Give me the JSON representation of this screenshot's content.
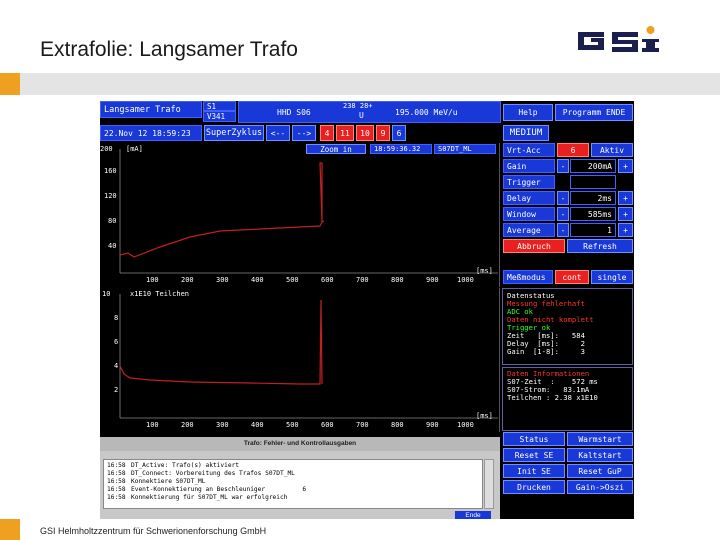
{
  "slide": {
    "title": "Extrafolie: Langsamer Trafo",
    "footer": "GSI Helmholtzzentrum für Schwerionenforschung GmbH",
    "logo_text": "GSI"
  },
  "topbar": {
    "device_name": "Langsamer Trafo",
    "id1": "S1",
    "id2": "V341",
    "beam_line1": "238  28+",
    "beam_element": "HHD S06",
    "beam_ion": "U",
    "beam_energy": "195.000 MeV/u",
    "date": "22.Nov 12 18:59:23",
    "cycle": "SuperZyklus",
    "nav_back": "<--",
    "nav_fwd": "-->",
    "cycle_numbers": [
      "4",
      "11",
      "10",
      "9",
      "6"
    ],
    "zoom_label": "Zoom in",
    "zoom_time": "18:59:36.32",
    "zoom_device": "S07DT_ML"
  },
  "plot1": {
    "unit_label": "[mA]",
    "x_unit": "[ms]",
    "y_ticks": [
      "200",
      "160",
      "120",
      "80",
      "40"
    ],
    "x_ticks": [
      "100",
      "200",
      "300",
      "400",
      "500",
      "600",
      "700",
      "800",
      "900",
      "1000"
    ]
  },
  "plot2": {
    "unit_label": "x1E10 Teilchen",
    "x_unit": "[ms]",
    "y_ticks": [
      "10",
      "8",
      "6",
      "4",
      "2"
    ],
    "x_ticks": [
      "100",
      "200",
      "300",
      "400",
      "500",
      "600",
      "700",
      "800",
      "900",
      "1000"
    ]
  },
  "controls": {
    "help": "Help",
    "end_program": "Programm ENDE",
    "range": "MEDIUM",
    "vrtacc_label": "Vrt-Acc",
    "vrtacc_value": "6",
    "vrtacc_state": "Aktiv",
    "gain_label": "Gain",
    "gain_value": "200mA",
    "trigger_label": "Trigger",
    "delay_label": "Delay",
    "delay_value": "2ms",
    "window_label": "Window",
    "window_value": "585ms",
    "average_label": "Average",
    "average_value": "1",
    "minus": "-",
    "plus": "+",
    "abort": "Abbruch",
    "refresh": "Refresh",
    "mode_label": "Meßmodus",
    "mode_cont": "cont",
    "mode_single": "single"
  },
  "datastatus": {
    "title": "Datenstatus",
    "error_line": "Messung fehlerhaft",
    "adc_line": "ADC ok",
    "incomplete_line": "Daten nicht komplett",
    "trigger_line": "Trigger ok",
    "zeit_line": "Zeit   [ms]:   584",
    "delay_line": "Delay  [ms]:     2",
    "gain_line": "Gain  [1-8]:     3"
  },
  "datainfo": {
    "title": "Daten Informationen",
    "zeit_line": "S07-Zeit  :    572 ms",
    "strom_line": "S07-Strom:   83.1mA",
    "teilchen_line": "Teilchen : 2.38 x1E10"
  },
  "bottom_buttons": {
    "status": "Status",
    "warmstart": "Warmstart",
    "reset_se": "Reset SE",
    "kaltstart": "Kaltstart",
    "init_se": "Init SE",
    "reset_gup": "Reset GuP",
    "drucken": "Drucken",
    "gain_oszi": "Gain->Oszi"
  },
  "log": {
    "title": "Trafo: Fehler- und Kontrollausgaben",
    "lines": [
      {
        "time": "16:58",
        "text": "DT_Active: Trafo(s) aktiviert"
      },
      {
        "time": "16:58",
        "text": "DT_Connect: Vorbereitung des Trafos S07DT_ML"
      },
      {
        "time": "16:58",
        "text": "Konnektiere S07DT_ML"
      },
      {
        "time": "16:58",
        "text": "Event-Konnektierung an Beschleuniger          6"
      },
      {
        "time": "16:58",
        "text": "Konnektierung für S07DT_ML war erfolgreich"
      }
    ],
    "close": "Ende"
  },
  "colors": {
    "accent": "#f0a020",
    "button_blue": "#1838d8",
    "button_red": "#e82020",
    "status_red": "#ff3030",
    "status_green": "#30ff30",
    "trace": "#c02020"
  }
}
